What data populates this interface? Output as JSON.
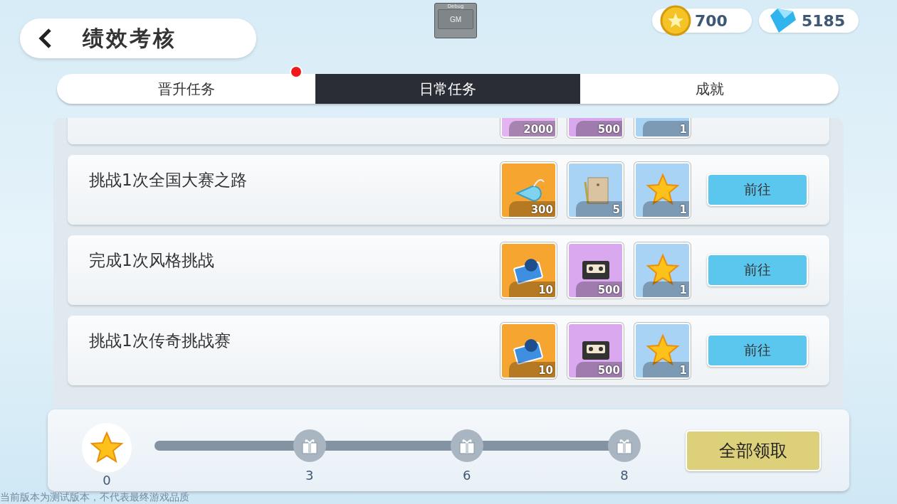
{
  "header": {
    "title": "绩效考核"
  },
  "debug": {
    "label": "Debug",
    "button": "GM"
  },
  "currencies": [
    {
      "kind": "coin",
      "amount": "700"
    },
    {
      "kind": "gem",
      "amount": "5185"
    }
  ],
  "tabs": [
    {
      "label": "晋升任务",
      "selected": false,
      "badge": true
    },
    {
      "label": "日常任务",
      "selected": true,
      "badge": false
    },
    {
      "label": "成就",
      "selected": false,
      "badge": false
    }
  ],
  "tasks": [
    {
      "rewards": [
        {
          "color": "#e3b4f0",
          "count": "2000"
        },
        {
          "color": "#d9a8ee",
          "count": "500"
        },
        {
          "color": "#a9d3f5",
          "count": "1"
        }
      ]
    },
    {
      "title": "挑战1次全国大赛之路",
      "button": "前往",
      "rewards": [
        {
          "kind": "whistle",
          "color": "#f7a531",
          "count": "300"
        },
        {
          "kind": "envelope",
          "color": "#a9d3f5",
          "count": "5"
        },
        {
          "kind": "star",
          "color": "#a9d3f5",
          "count": "1"
        }
      ]
    },
    {
      "title": "完成1次风格挑战",
      "button": "前往",
      "rewards": [
        {
          "kind": "card",
          "color": "#f7a531",
          "count": "10"
        },
        {
          "kind": "tape",
          "color": "#d9a8ee",
          "count": "500"
        },
        {
          "kind": "star",
          "color": "#a9d3f5",
          "count": "1"
        }
      ]
    },
    {
      "title": "挑战1次传奇挑战赛",
      "button": "前往",
      "rewards": [
        {
          "kind": "card",
          "color": "#f7a531",
          "count": "10"
        },
        {
          "kind": "tape",
          "color": "#d9a8ee",
          "count": "500"
        },
        {
          "kind": "star",
          "color": "#a9d3f5",
          "count": "1"
        }
      ]
    }
  ],
  "progress": {
    "stars": "0",
    "milestones": [
      "3",
      "6",
      "8"
    ],
    "claim_button": "全部领取"
  },
  "disclaimer": "当前版本为测试版本，不代表最终游戏品质"
}
